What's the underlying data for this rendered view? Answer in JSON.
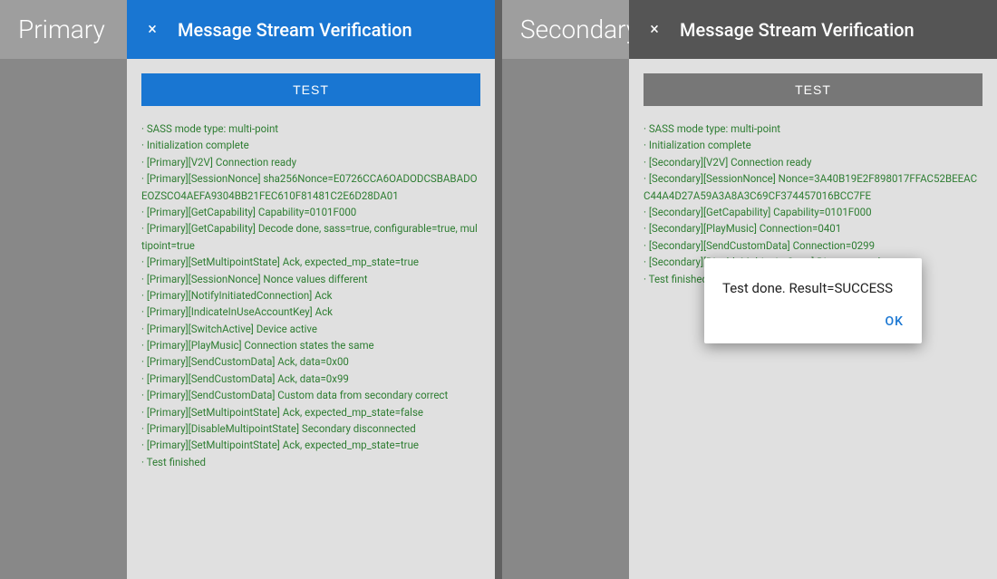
{
  "primary": {
    "label": "Primary",
    "dialog": {
      "title": "Message Stream Verification",
      "close_icon": "×",
      "test_button": "TEST",
      "log_lines": "· SASS mode type: multi-point\n· Initialization complete\n· [Primary][V2V] Connection ready\n· [Primary][SessionNonce] sha256Nonce=E0726CCA6OADODCSBABADOEOZSCO4AEFA9304BB21FEC610F81481C2E6D28DA01\n· [Primary][GetCapability] Capability=0101F000\n· [Primary][GetCapability] Decode done, sass=true, configurable=true, multipoint=true\n· [Primary][SetMultipointState] Ack, expected_mp_state=true\n· [Primary][SessionNonce] Nonce values different\n· [Primary][NotifyInitiatedConnection] Ack\n· [Primary][IndicateInUseAccountKey] Ack\n· [Primary][SwitchActive] Device active\n· [Primary][PlayMusic] Connection states the same\n· [Primary][SendCustomData] Ack, data=0x00\n· [Primary][SendCustomData] Ack, data=0x99\n· [Primary][SendCustomData] Custom data from secondary correct\n· [Primary][SetMultipointState] Ack, expected_mp_state=false\n· [Primary][DisableMultipointState] Secondary disconnected\n· [Primary][SetMultipointState] Ack, expected_mp_state=true\n· Test finished"
    }
  },
  "secondary": {
    "label": "Secondary",
    "dialog": {
      "title": "Message Stream Verification",
      "close_icon": "×",
      "test_button": "TEST",
      "log_lines": "· SASS mode type: multi-point\n· Initialization complete\n· [Secondary][V2V] Connection ready\n· [Secondary][SessionNonce] Nonce=3A40B19E2F898017FFAC52BEEACC44A4D27A59A3A8A3C69CF374457016BCC7FE\n· [Secondary][GetCapability] Capability=0101F000\n· [Secondary][PlayMusic] Connection=0401\n· [Secondary][SendCustomData] Connection=0299\n· [Secondary][DisableMultipointState] Disconnected\n· Test finished",
      "result_dialog": {
        "text": "Test done. Result=SUCCESS",
        "ok_label": "OK"
      }
    }
  }
}
